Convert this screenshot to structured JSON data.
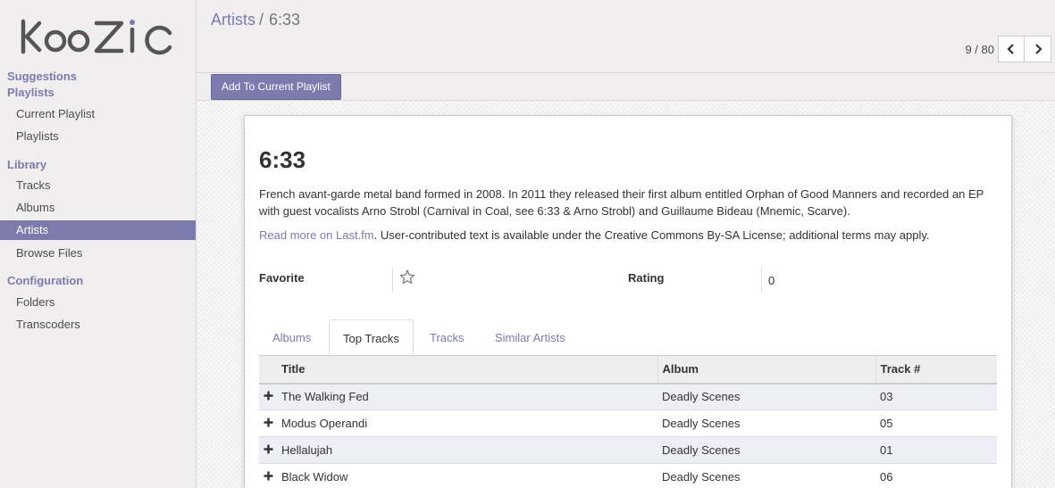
{
  "brand": {
    "logo_text": "Koozic",
    "accent_color": "#7c7bad"
  },
  "sidebar": {
    "sections": [
      {
        "label": "Suggestions"
      },
      {
        "label": "Playlists",
        "items": [
          {
            "label": "Current Playlist"
          },
          {
            "label": "Playlists"
          }
        ]
      },
      {
        "label": "Library",
        "items": [
          {
            "label": "Tracks"
          },
          {
            "label": "Albums"
          },
          {
            "label": "Artists",
            "active": true
          },
          {
            "label": "Browse Files"
          }
        ]
      },
      {
        "label": "Configuration",
        "items": [
          {
            "label": "Folders"
          },
          {
            "label": "Transcoders"
          }
        ]
      }
    ]
  },
  "breadcrumb": {
    "parent": "Artists",
    "separator": "/",
    "current": "6:33"
  },
  "pager": {
    "value": "9 / 80",
    "prev_icon": "chevron-left-icon",
    "next_icon": "chevron-right-icon"
  },
  "buttons": {
    "add_to_playlist": "Add To Current Playlist"
  },
  "artist": {
    "name": "6:33",
    "bio": "French avant-garde metal band formed in 2008. In 2011 they released their first album entitled Orphan of Good Manners and recorded an EP with guest vocalists Arno Strobl (Carnival in Coal, see 6:33 & Arno Strobl) and Guillaume Bideau (Mnemic, Scarve).",
    "read_more": "Read more on Last.fm",
    "license": ". User-contributed text is available under the Creative Commons By-SA License; additional terms may apply.",
    "favorite_label": "Favorite",
    "favorite_icon": "star-outline-icon",
    "rating_label": "Rating",
    "rating_value": "0"
  },
  "tabs": [
    {
      "label": "Albums"
    },
    {
      "label": "Top Tracks",
      "active": true
    },
    {
      "label": "Tracks"
    },
    {
      "label": "Similar Artists"
    }
  ],
  "table": {
    "columns": [
      "Title",
      "Album",
      "Track #"
    ],
    "rows": [
      {
        "title": "The Walking Fed",
        "album": "Deadly Scenes",
        "track": "03"
      },
      {
        "title": "Modus Operandi",
        "album": "Deadly Scenes",
        "track": "05"
      },
      {
        "title": "Hellalujah",
        "album": "Deadly Scenes",
        "track": "01"
      },
      {
        "title": "Black Widow",
        "album": "Deadly Scenes",
        "track": "06"
      }
    ]
  }
}
